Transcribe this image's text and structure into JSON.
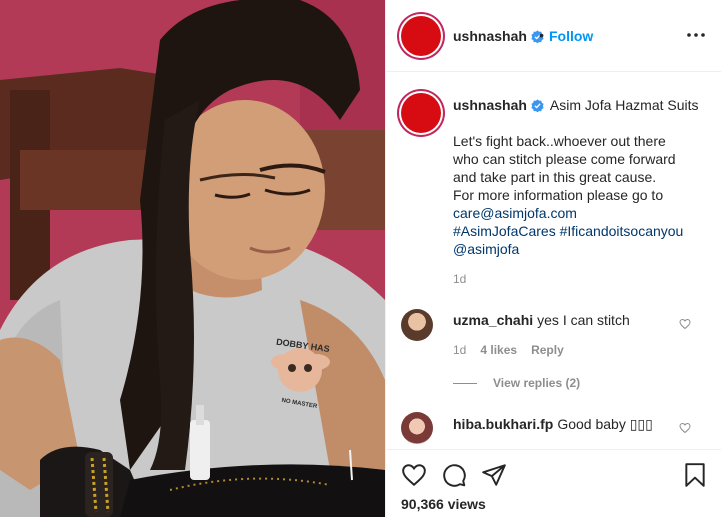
{
  "header": {
    "username": "ushnashah",
    "separator": "•",
    "follow_label": "Follow",
    "more_icon": "more-horizontal-icon"
  },
  "caption": {
    "username": "ushnashah",
    "subtitle": "Asim Jofa Hazmat Suits",
    "lines": [
      "Let's fight back..whoever out there",
      "who can stitch please come forward",
      "and take part in this great cause.",
      "For more information please go to"
    ],
    "email_link": "care@asimjofa.com",
    "hashtag_1": "#AsimJofaCares",
    "hashtag_2": "#Ificandoitsocanyou",
    "mention": "@asimjofa",
    "time": "1d"
  },
  "comments": [
    {
      "username": "uzma_chahi",
      "text": "yes I can stitch",
      "time": "1d",
      "likes": "4 likes",
      "reply_label": "Reply",
      "view_replies": "View replies (2)"
    },
    {
      "username": "hiba.bukhari.fp",
      "text": "Good baby ▯▯▯"
    }
  ],
  "actions": {
    "views": "90,366 views",
    "icons": [
      "heart-icon",
      "comment-icon",
      "share-icon",
      "bookmark-icon"
    ]
  },
  "photo": {
    "tshirt_print_line1": "DOBBY HAS",
    "tshirt_print_line2": "NO MASTER"
  },
  "colors": {
    "accent": "#0095f6",
    "link": "#00376b",
    "muted": "#8e8e8e",
    "verified": "#3897f0",
    "avatar_red": "#d60c12"
  }
}
